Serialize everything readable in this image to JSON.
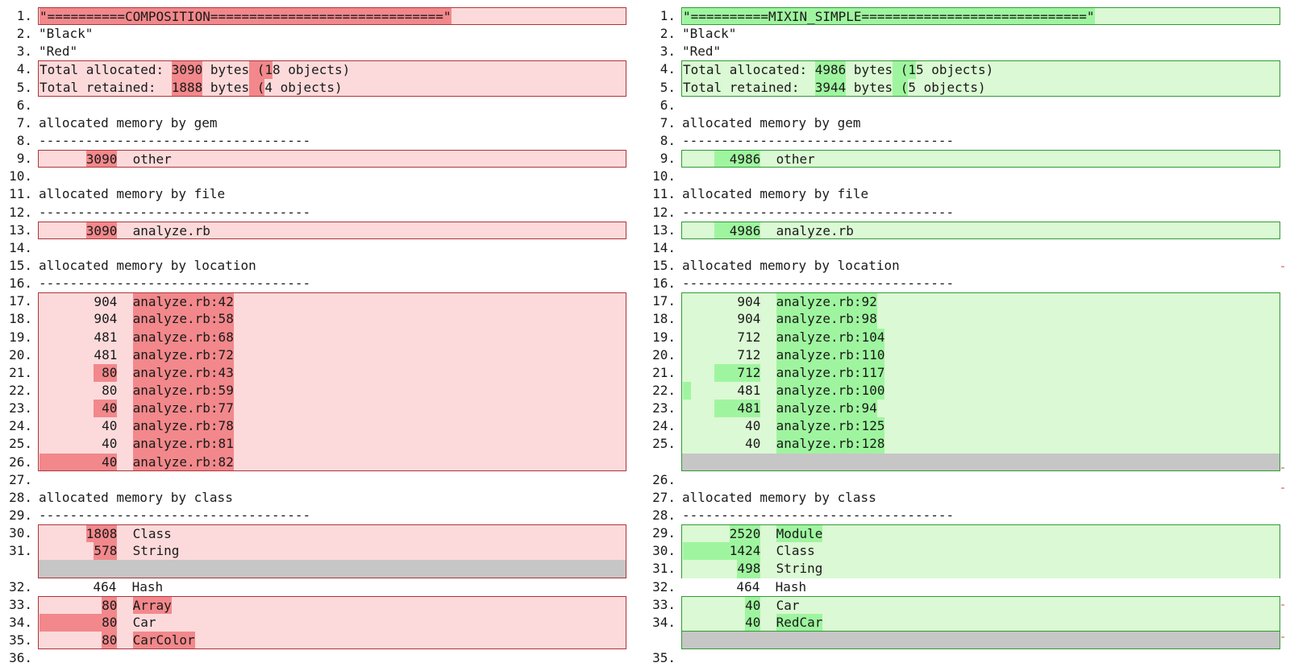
{
  "colors": {
    "deleted_line_bg": "#fcdadb",
    "deleted_word_bg": "#f2888b",
    "deleted_border": "#b1333a",
    "added_line_bg": "#dbf9d4",
    "added_word_bg": "#9ff59f",
    "added_border": "#2f9b36",
    "filler_bg": "#c6c6c6"
  },
  "left": {
    "lines": [
      {
        "num": "1.",
        "text": "\"==========COMPOSITION==============================\""
      },
      {
        "num": "2.",
        "text": "\"Black\""
      },
      {
        "num": "3.",
        "text": "\"Red\""
      },
      {
        "num": "4.",
        "text": "Total allocated: 3090 bytes (18 objects)"
      },
      {
        "num": "5.",
        "text": "Total retained:  1888 bytes (4 objects)"
      },
      {
        "num": "6.",
        "text": ""
      },
      {
        "num": "7.",
        "text": "allocated memory by gem"
      },
      {
        "num": "8.",
        "text": "-----------------------------------"
      },
      {
        "num": "9.",
        "text": "      3090  other"
      },
      {
        "num": "10.",
        "text": ""
      },
      {
        "num": "11.",
        "text": "allocated memory by file"
      },
      {
        "num": "12.",
        "text": "-----------------------------------"
      },
      {
        "num": "13.",
        "text": "      3090  analyze.rb"
      },
      {
        "num": "14.",
        "text": ""
      },
      {
        "num": "15.",
        "text": "allocated memory by location"
      },
      {
        "num": "16.",
        "text": "-----------------------------------"
      },
      {
        "num": "17.",
        "text": "       904  analyze.rb:42"
      },
      {
        "num": "18.",
        "text": "       904  analyze.rb:58"
      },
      {
        "num": "19.",
        "text": "       481  analyze.rb:68"
      },
      {
        "num": "20.",
        "text": "       481  analyze.rb:72"
      },
      {
        "num": "21.",
        "text": "        80  analyze.rb:43"
      },
      {
        "num": "22.",
        "text": "        80  analyze.rb:59"
      },
      {
        "num": "23.",
        "text": "        40  analyze.rb:77"
      },
      {
        "num": "24.",
        "text": "        40  analyze.rb:78"
      },
      {
        "num": "25.",
        "text": "        40  analyze.rb:81"
      },
      {
        "num": "26.",
        "text": "        40  analyze.rb:82"
      },
      {
        "num": "27.",
        "text": ""
      },
      {
        "num": "28.",
        "text": "allocated memory by class"
      },
      {
        "num": "29.",
        "text": "-----------------------------------"
      },
      {
        "num": "30.",
        "text": "      1808  Class"
      },
      {
        "num": "31.",
        "text": "       578  String"
      },
      {
        "num": "",
        "text": ""
      },
      {
        "num": "32.",
        "text": "       464  Hash"
      },
      {
        "num": "33.",
        "text": "        80  Array"
      },
      {
        "num": "34.",
        "text": "        80  Car"
      },
      {
        "num": "35.",
        "text": "        80  CarColor"
      },
      {
        "num": "36.",
        "text": ""
      }
    ]
  },
  "right": {
    "lines": [
      {
        "num": "1.",
        "text": "\"==========MIXIN_SIMPLE=============================\""
      },
      {
        "num": "2.",
        "text": "\"Black\""
      },
      {
        "num": "3.",
        "text": "\"Red\""
      },
      {
        "num": "4.",
        "text": "Total allocated: 4986 bytes (15 objects)"
      },
      {
        "num": "5.",
        "text": "Total retained:  3944 bytes (5 objects)"
      },
      {
        "num": "6.",
        "text": ""
      },
      {
        "num": "7.",
        "text": "allocated memory by gem"
      },
      {
        "num": "8.",
        "text": "-----------------------------------"
      },
      {
        "num": "9.",
        "text": "      4986  other"
      },
      {
        "num": "10.",
        "text": ""
      },
      {
        "num": "11.",
        "text": "allocated memory by file"
      },
      {
        "num": "12.",
        "text": "-----------------------------------"
      },
      {
        "num": "13.",
        "text": "      4986  analyze.rb"
      },
      {
        "num": "14.",
        "text": ""
      },
      {
        "num": "15.",
        "text": "allocated memory by location"
      },
      {
        "num": "16.",
        "text": "-----------------------------------"
      },
      {
        "num": "17.",
        "text": "       904  analyze.rb:92"
      },
      {
        "num": "18.",
        "text": "       904  analyze.rb:98"
      },
      {
        "num": "19.",
        "text": "       712  analyze.rb:104"
      },
      {
        "num": "20.",
        "text": "       712  analyze.rb:110"
      },
      {
        "num": "21.",
        "text": "       712  analyze.rb:117"
      },
      {
        "num": "22.",
        "text": "       481  analyze.rb:100"
      },
      {
        "num": "23.",
        "text": "       481  analyze.rb:94"
      },
      {
        "num": "24.",
        "text": "        40  analyze.rb:125"
      },
      {
        "num": "25.",
        "text": "        40  analyze.rb:128"
      },
      {
        "num": "",
        "text": ""
      },
      {
        "num": "26.",
        "text": ""
      },
      {
        "num": "27.",
        "text": "allocated memory by class"
      },
      {
        "num": "28.",
        "text": "-----------------------------------"
      },
      {
        "num": "29.",
        "text": "      2520  Module"
      },
      {
        "num": "30.",
        "text": "      1424  Class"
      },
      {
        "num": "31.",
        "text": "       498  String"
      },
      {
        "num": "32.",
        "text": "       464  Hash"
      },
      {
        "num": "33.",
        "text": "        40  Car"
      },
      {
        "num": "34.",
        "text": "        40  RedCar"
      },
      {
        "num": "",
        "text": ""
      },
      {
        "num": "35.",
        "text": ""
      }
    ]
  }
}
